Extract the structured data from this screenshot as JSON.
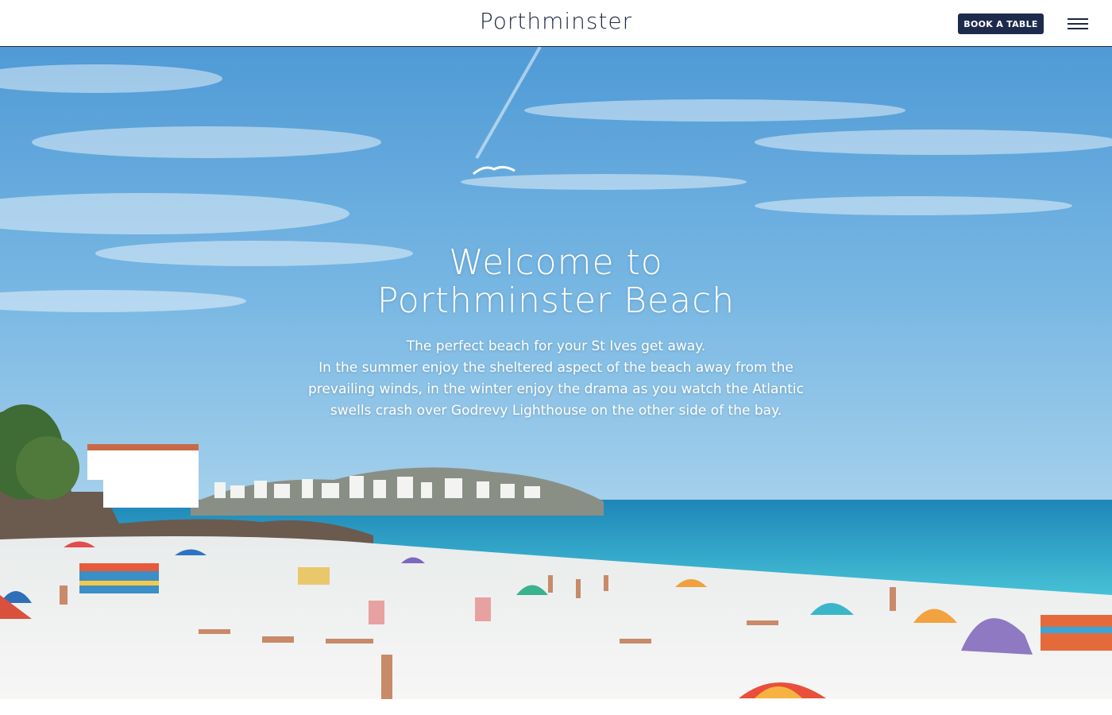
{
  "header": {
    "logo": "Porthminster",
    "book_button": "BOOK A TABLE",
    "menu_icon": "hamburger-menu-icon"
  },
  "hero": {
    "title_line1": "Welcome to",
    "title_line2": "Porthminster Beach",
    "intro": "The perfect beach for your St Ives get away.",
    "body": "In the summer enjoy the sheltered aspect of the beach away from the prevailing winds, in the winter enjoy the drama as you watch the Atlantic swells crash over Godrevy Lighthouse on the other side of the bay."
  },
  "colors": {
    "brand_navy": "#1e2a4c",
    "sky_top": "#4f9ad6",
    "sea": "#2aa6c7",
    "sand": "#eef0f0"
  }
}
